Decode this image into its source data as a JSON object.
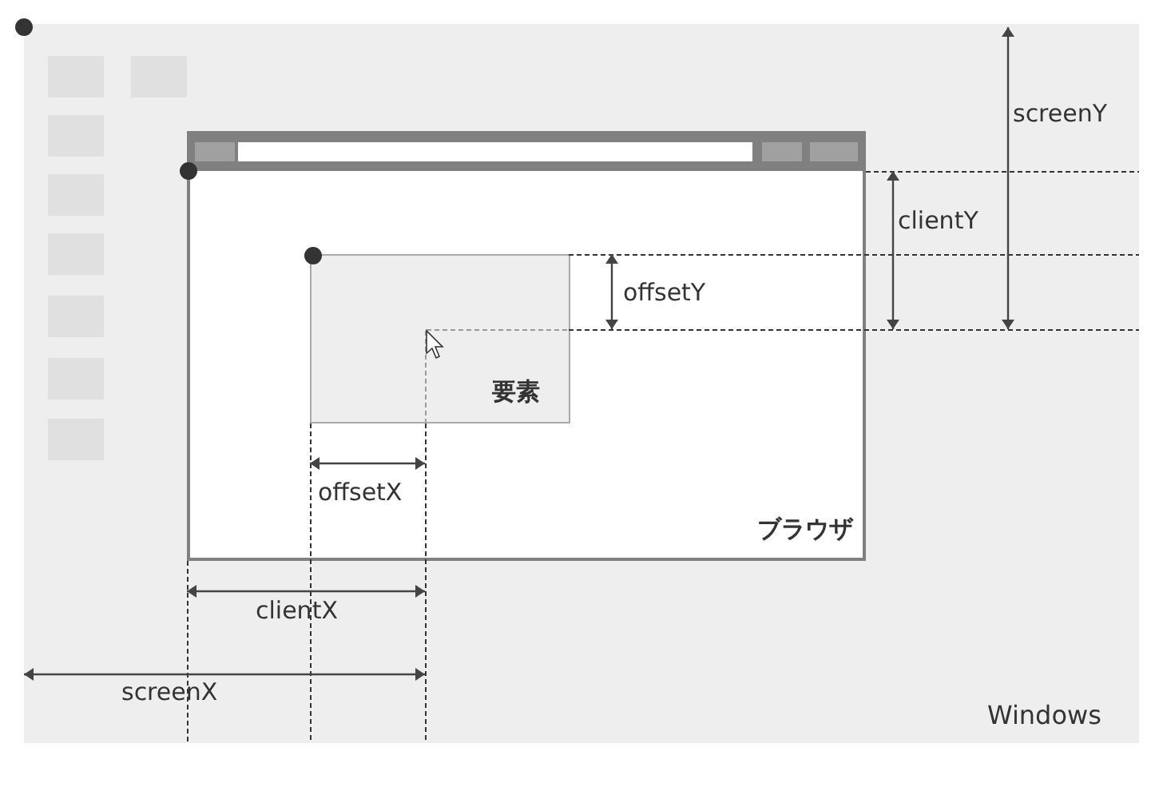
{
  "desktop": {
    "label": "Windows"
  },
  "browser": {
    "label": "ブラウザ"
  },
  "element": {
    "label": "要素"
  },
  "measures": [
    {
      "kind": "vertical",
      "label": "screenY"
    },
    {
      "kind": "vertical",
      "label": "clientY"
    },
    {
      "kind": "vertical",
      "label": "offsetY"
    },
    {
      "kind": "horizontal",
      "label": "offsetX"
    },
    {
      "kind": "horizontal",
      "label": "clientX"
    },
    {
      "kind": "horizontal",
      "label": "screenX"
    }
  ]
}
